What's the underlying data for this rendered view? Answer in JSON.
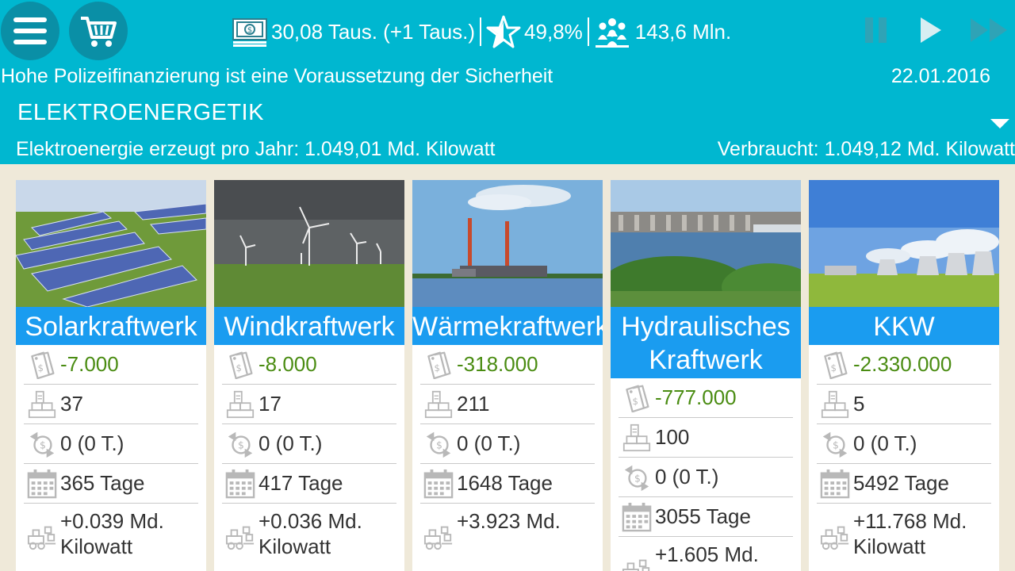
{
  "header": {
    "money": "30,08 Taus. (+1 Taus.)",
    "rating": "49,8%",
    "population": "143,6 Mln.",
    "motto": "Hohe Polizeifinanzierung ist eine Voraussetzung der Sicherheit",
    "date": "22.01.2016",
    "section_title": "ELEKTROENERGETIK",
    "produced": "Elektroenergie erzeugt pro Jahr: 1.049,01 Md. Kilowatt",
    "consumed": "Verbraucht: 1.049,12 Md. Kilowatt"
  },
  "cards": [
    {
      "title": "Solarkraftwerk",
      "cost": "-7.000",
      "count": "37",
      "income": "0 (0 T.)",
      "duration": "365 Tage",
      "energy": "+0.039 Md. Kilowatt"
    },
    {
      "title": "Windkraftwerk",
      "cost": "-8.000",
      "count": "17",
      "income": "0 (0 T.)",
      "duration": "417 Tage",
      "energy": "+0.036 Md. Kilowatt"
    },
    {
      "title": "Wärmekraftwerk",
      "cost": "-318.000",
      "count": "211",
      "income": "0 (0 T.)",
      "duration": "1648 Tage",
      "energy": "+3.923 Md."
    },
    {
      "title": "Hydraulisches Kraftwerk",
      "cost": "-777.000",
      "count": "100",
      "income": "0 (0 T.)",
      "duration": "3055 Tage",
      "energy": "+1.605 Md."
    },
    {
      "title": "KKW",
      "cost": "-2.330.000",
      "count": "5",
      "income": "0 (0 T.)",
      "duration": "5492 Tage",
      "energy": "+11.768 Md. Kilowatt"
    }
  ]
}
